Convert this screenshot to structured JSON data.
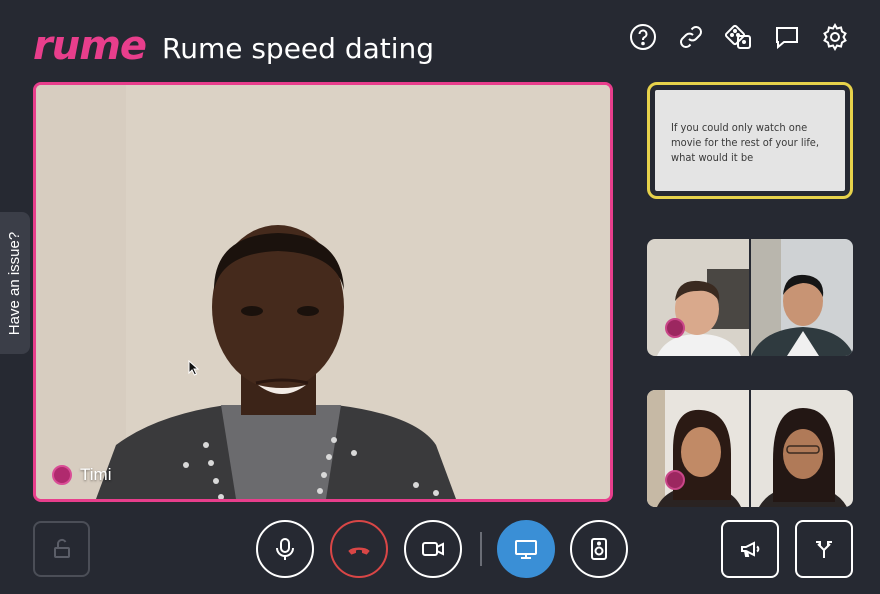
{
  "header": {
    "logo": "rume",
    "title": "Rume speed dating",
    "icons": [
      "help-icon",
      "link-icon",
      "dice-icon",
      "chat-icon",
      "settings-icon"
    ]
  },
  "side_tab": {
    "label": "Have an issue?"
  },
  "main_video": {
    "participant_name": "Timi"
  },
  "question_card": {
    "text": "If you could only watch one movie for the rest of your life, what would it be"
  },
  "controls": {
    "left": [
      "lock-icon"
    ],
    "center": [
      "microphone-icon",
      "hang-up-icon",
      "camera-icon",
      "screen-share-icon",
      "speaker-icon"
    ],
    "right": [
      "megaphone-icon",
      "split-icon"
    ]
  },
  "colors": {
    "background": "#262932",
    "brand": "#e83e8c",
    "question_border": "#e7d24b",
    "active": "#3a8fd6",
    "hangup": "#d94646"
  }
}
